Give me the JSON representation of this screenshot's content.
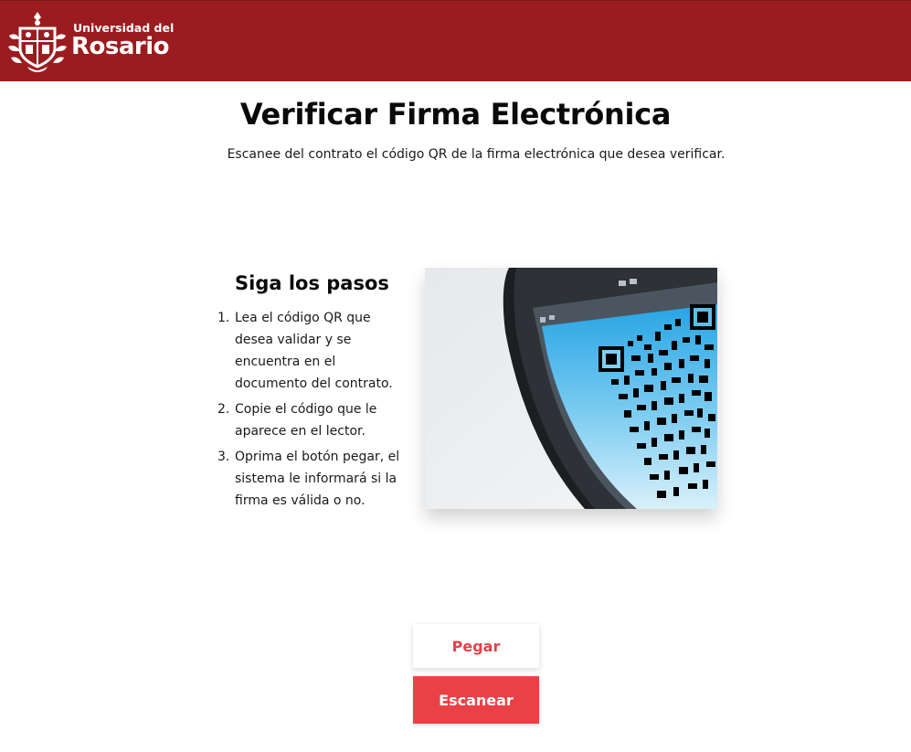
{
  "header": {
    "brand_line1": "Universidad del",
    "brand_line2": "Rosario",
    "logo_icon": "university-crest-icon",
    "background_color": "#9b1c1f"
  },
  "main": {
    "title": "Verificar Firma Electrónica",
    "subtitle": "Escanee del contrato el código QR de la firma electrónica que desea verificar."
  },
  "steps": {
    "title": "Siga los pasos",
    "items": [
      {
        "number": "1.",
        "text": "Lea el código QR que desea validar y se encuentra en el documento del contrato."
      },
      {
        "number": "2.",
        "text": "Copie el código que le aparece en el lector."
      },
      {
        "number": "3.",
        "text": "Oprima el botón pegar, el sistema le informará si la firma es válida o no."
      }
    ]
  },
  "illustration": {
    "icon": "phone-scanning-qr-code-image"
  },
  "actions": {
    "paste_label": "Pegar",
    "scan_label": "Escanear",
    "accent_color": "#ea4146"
  }
}
